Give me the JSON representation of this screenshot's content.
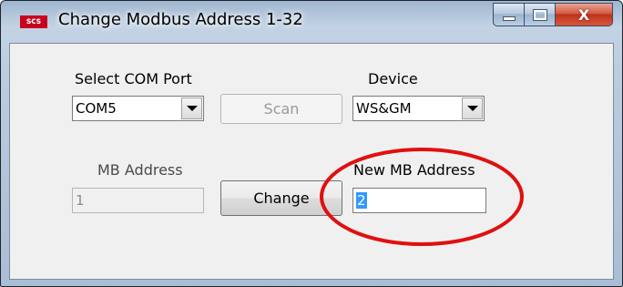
{
  "window": {
    "title": "Change Modbus Address 1-32",
    "logo_text": "scs",
    "buttons": {
      "minimize": "minimize",
      "maximize": "maximize",
      "close": "X"
    }
  },
  "com_port": {
    "label": "Select COM Port",
    "value": "COM5"
  },
  "scan_button": {
    "label": "Scan",
    "enabled": false
  },
  "device": {
    "label": "Device",
    "value": "WS&GM"
  },
  "mb_address": {
    "label": "MB Address",
    "value": "1",
    "enabled": false
  },
  "change_button": {
    "label": "Change"
  },
  "new_mb_address": {
    "label": "New MB Address",
    "value": "2"
  },
  "colors": {
    "highlight_circle": "#e01010",
    "selection": "#3399ff"
  }
}
